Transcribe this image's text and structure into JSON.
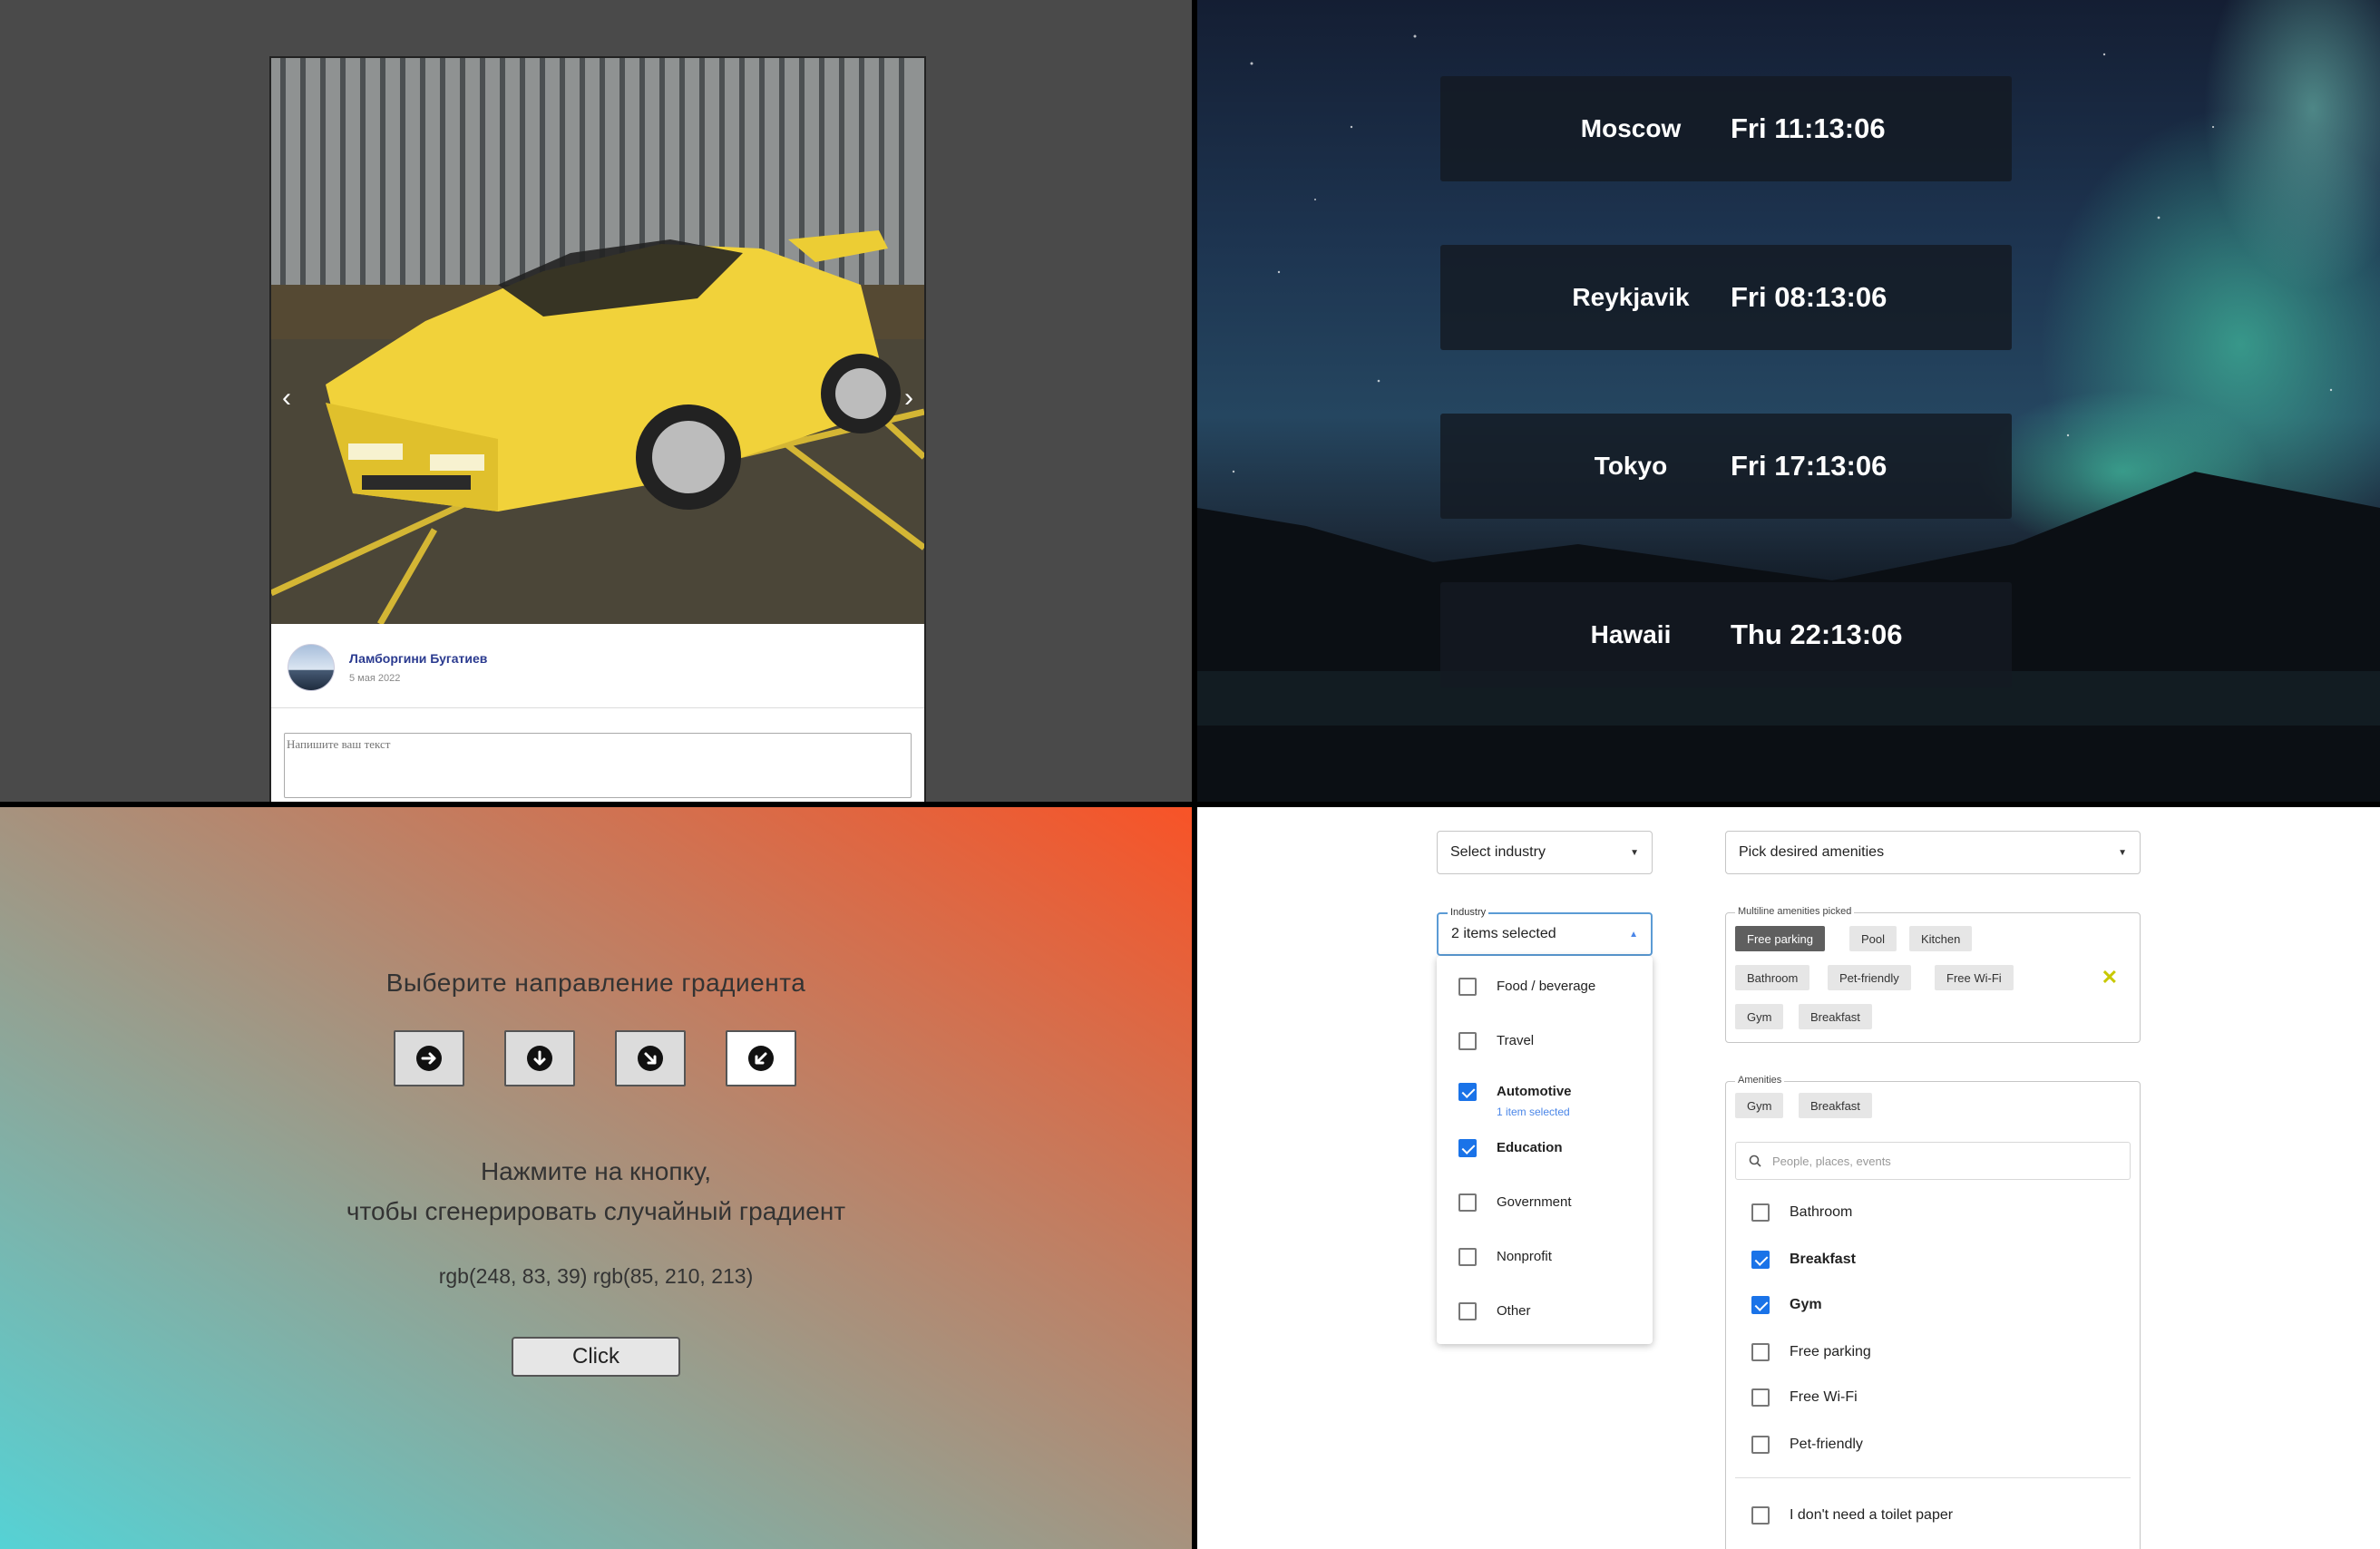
{
  "post": {
    "author_name": "Ламборгини Бугатиев",
    "date": "5 мая 2022",
    "comment_placeholder": "Напишите ваш текст",
    "prev_arrow": "‹",
    "next_arrow": "›"
  },
  "clocks": [
    {
      "city": "Moscow",
      "time": "Fri 11:13:06"
    },
    {
      "city": "Reykjavik",
      "time": "Fri 08:13:06"
    },
    {
      "city": "Tokyo",
      "time": "Fri 17:13:06"
    },
    {
      "city": "Hawaii",
      "time": "Thu 22:13:06"
    }
  ],
  "gradient": {
    "title": "Выберите направление градиента",
    "hint_line1": "Нажмите на кнопку,",
    "hint_line2": "чтобы сгенерировать случайный градиент",
    "rgb_text": "rgb(248, 83, 39) rgb(85, 210, 213)",
    "click_label": "Click",
    "color_start": "#f85327",
    "color_end": "#55d2d5",
    "directions": [
      "arrow-right-icon",
      "arrow-down-icon",
      "arrow-down-right-icon",
      "arrow-down-left-icon"
    ],
    "active_direction": "arrow-down-left-icon"
  },
  "selects": {
    "industry_placeholder": "Select industry",
    "amenities_placeholder": "Pick desired amenities",
    "industry_label": "Industry",
    "industry_value": "2 items selected",
    "industry_options": [
      {
        "label": "Food / beverage",
        "checked": false
      },
      {
        "label": "Travel",
        "checked": false
      },
      {
        "label": "Automotive",
        "checked": true,
        "sub": "1 item selected"
      },
      {
        "label": "Education",
        "checked": true
      },
      {
        "label": "Government",
        "checked": false
      },
      {
        "label": "Nonprofit",
        "checked": false
      },
      {
        "label": "Other",
        "checked": false
      }
    ],
    "multiline_label": "Multiline amenities picked",
    "multiline_chips": [
      "Free parking",
      "Pool",
      "Kitchen",
      "Bathroom",
      "Pet-friendly",
      "Free Wi-Fi",
      "Gym",
      "Breakfast"
    ],
    "clear_icon": "✕",
    "amenities_label": "Amenities",
    "amenities_chips": [
      "Gym",
      "Breakfast"
    ],
    "search_placeholder": "People, places, events",
    "amenities_options": [
      {
        "label": "Bathroom",
        "checked": false
      },
      {
        "label": "Breakfast",
        "checked": true
      },
      {
        "label": "Gym",
        "checked": true
      },
      {
        "label": "Free parking",
        "checked": false
      },
      {
        "label": "Free Wi-Fi",
        "checked": false
      },
      {
        "label": "Pet-friendly",
        "checked": false
      }
    ],
    "extra_option": "I don't need a toilet paper"
  }
}
